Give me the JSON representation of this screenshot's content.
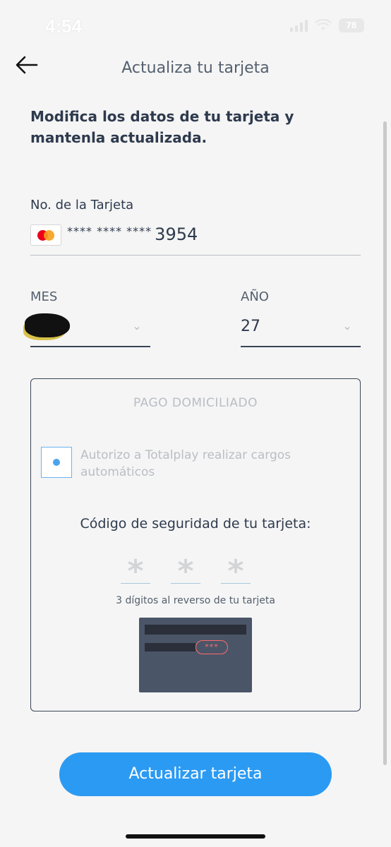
{
  "status_bar": {
    "time": "4:54",
    "battery": "78"
  },
  "header": {
    "title": "Actualiza tu tarjeta",
    "back_icon": "arrow-left-icon"
  },
  "headline": "Modifica los datos de tu tarjeta y mantenla actualizada.",
  "card": {
    "label": "No. de la Tarjeta",
    "brand_icon": "mastercard-icon",
    "masked": "**** **** ****",
    "last_digits": "3954"
  },
  "expiry": {
    "month_label": "MES",
    "month_value": "",
    "year_label": "AÑO",
    "year_value": "27"
  },
  "pago_domiciliado": {
    "title": "PAGO DOMICILIADO",
    "autorizo_text": "Autorizo a Totalplay realizar cargos automáticos",
    "cvv_title": "Código de seguridad de tu tarjeta:",
    "cvv_placeholders": [
      "*",
      "*",
      "*"
    ],
    "cvv_hint": "3 dígitos al reverso de tu tarjeta",
    "card_back_cvv": "***"
  },
  "button": {
    "label": "Actualizar tarjeta"
  },
  "colors": {
    "primary": "#2b9af3",
    "text": "#2e3a4d",
    "disabled_text": "#b9bec4",
    "background": "#f5f5f5"
  }
}
